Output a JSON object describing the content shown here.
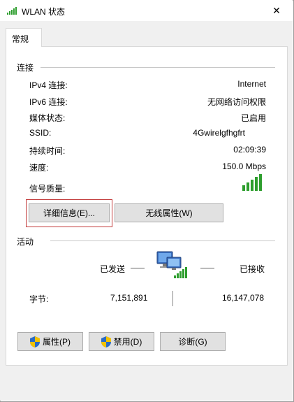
{
  "window": {
    "title": "WLAN 状态",
    "close_glyph": "✕"
  },
  "tabs": [
    {
      "label": "常规"
    }
  ],
  "connection": {
    "section_label": "连接",
    "rows": [
      {
        "label": "IPv4 连接:",
        "value": "Internet"
      },
      {
        "label": "IPv6 连接:",
        "value": "无网络访问权限"
      },
      {
        "label": "媒体状态:",
        "value": "已启用"
      },
      {
        "label": "SSID:",
        "value": "4Gwirelgfhgfrt"
      },
      {
        "label": "持续时间:",
        "value": "02:09:39"
      },
      {
        "label": "速度:",
        "value": "150.0 Mbps"
      },
      {
        "label": "信号质量:",
        "value": ""
      }
    ],
    "signal_bars": 5,
    "details_button": "详细信息(E)...",
    "wireless_props_button": "无线属性(W)"
  },
  "activity": {
    "section_label": "活动",
    "sent_label": "已发送",
    "received_label": "已接收",
    "bytes_label": "字节:",
    "bytes_sent": "7,151,891",
    "bytes_received": "16,147,078"
  },
  "footer": {
    "properties_button": "属性(P)",
    "disable_button": "禁用(D)",
    "diagnose_button": "诊断(G)"
  },
  "colors": {
    "signal_green": "#2e9e2e",
    "highlight_red": "#c23a3a",
    "shield_blue": "#2b6cc4",
    "shield_yellow": "#f2c200"
  }
}
